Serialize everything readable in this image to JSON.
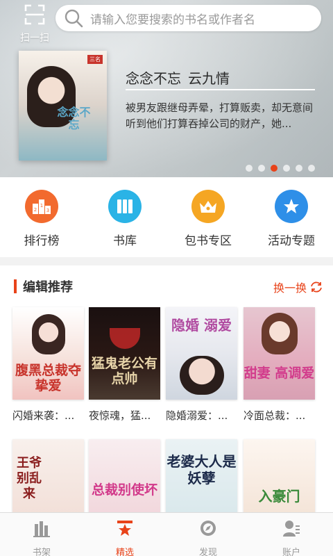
{
  "scan": {
    "label": "扫一扫"
  },
  "search": {
    "placeholder": "请输入您要搜索的书名或作者名"
  },
  "banner": {
    "title": "念念不忘",
    "author": "云九情",
    "description": "被男友跟继母弄晕，打算贩卖，却无意间听到他们打算吞掉公司的财产，她...",
    "cover_text": "念念不忘",
    "dots": 6,
    "active_dot": 2
  },
  "categories": [
    {
      "label": "排行榜",
      "icon": "ranking-icon",
      "color": "#f26a2e"
    },
    {
      "label": "书库",
      "icon": "library-icon",
      "color": "#2ab3e6"
    },
    {
      "label": "包书专区",
      "icon": "crown-icon",
      "color": "#f5a623"
    },
    {
      "label": "活动专题",
      "icon": "star-icon",
      "color": "#2e8fe8"
    }
  ],
  "editor_picks": {
    "title": "编辑推荐",
    "refresh_label": "换一换",
    "books": [
      {
        "title": "闪婚来袭：...",
        "cover_text": "腹黑总裁夺挚爱",
        "cover_color": "#c8342c"
      },
      {
        "title": "夜惊魂，猛...",
        "cover_text": "猛鬼老公有点帅",
        "cover_color": "#e6d3a8"
      },
      {
        "title": "隐婚溺爱：...",
        "cover_text": "隐婚 溺爱",
        "cover_color": "#b04aa0"
      },
      {
        "title": "冷面总裁：...",
        "cover_text": "甜妻 高调爱",
        "cover_color": "#d23c8c"
      }
    ],
    "books_row2": [
      {
        "cover_text": "王爷别乱来",
        "cover_color": "#8a1d1d"
      },
      {
        "cover_text": "总裁别使坏",
        "cover_color": "#d2398a"
      },
      {
        "cover_text": "老婆大人是妖孽",
        "cover_color": "#1c2a4a"
      },
      {
        "cover_text": "入豪门",
        "cover_color": "#3a8a3a"
      }
    ]
  },
  "nav": [
    {
      "label": "书架",
      "icon": "bookshelf-icon"
    },
    {
      "label": "精选",
      "icon": "featured-icon",
      "active": true
    },
    {
      "label": "发现",
      "icon": "discover-icon"
    },
    {
      "label": "账户",
      "icon": "account-icon"
    }
  ],
  "colors": {
    "accent": "#e8431a"
  }
}
